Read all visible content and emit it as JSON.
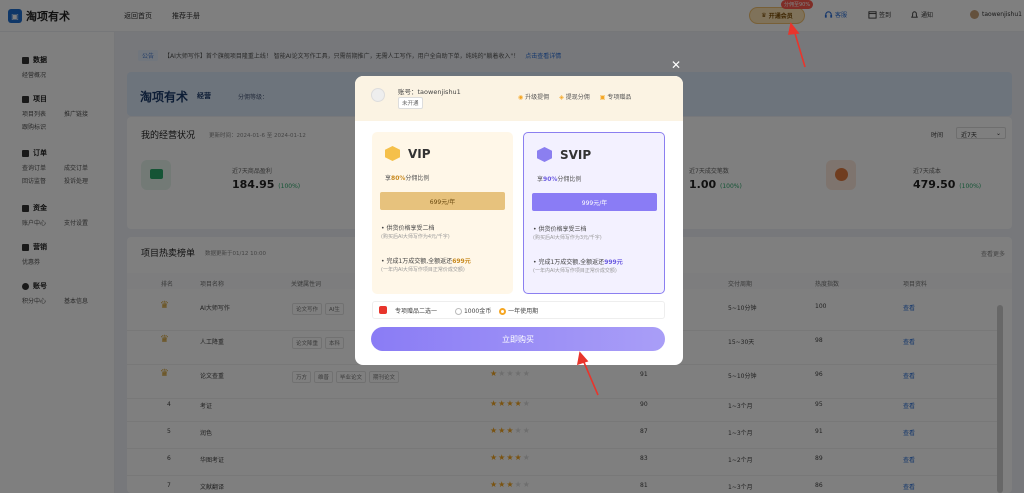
{
  "topbar": {
    "logo_text": "淘项有术",
    "nav": [
      "返回首页",
      "推荐手册"
    ],
    "vip_btn": "开通会员",
    "vip_badge": "分佣至90%",
    "items": [
      "客服",
      "签到",
      "通知"
    ],
    "username": "taowenjishu1"
  },
  "sidebar": {
    "groups": [
      {
        "title": "数据",
        "subs": [
          "经营概况"
        ]
      },
      {
        "title": "项目",
        "subs": [
          "项目列表",
          "推广链接",
          "跟购标识"
        ]
      },
      {
        "title": "订单",
        "subs": [
          "查询订单",
          "成交订单",
          "回访监督",
          "投诉处理"
        ]
      },
      {
        "title": "资金",
        "subs": [
          "账户中心",
          "支付设置"
        ]
      },
      {
        "title": "营销",
        "subs": [
          "优惠券"
        ]
      },
      {
        "title": "账号",
        "subs": [
          "积分中心",
          "基本信息"
        ]
      }
    ]
  },
  "notice": {
    "tag": "公告",
    "text": "【AI大师写作】首个旗舰项目隆重上线！ 智能AI论文写作工具，只需前期推广，无需人工写作，用户全自助下单，纯纯的\"躺着收入\"！",
    "link": "点击查看详情"
  },
  "banner": {
    "title": "淘项有术",
    "sub": "经营",
    "level_label": "分佣等级："
  },
  "overview": {
    "title": "我的经营状况",
    "time": "更新时间：2024-01-6 至 2024-01-12",
    "filter_label": "时间",
    "filter_value": "近7天",
    "stats": [
      {
        "label": "近7天商品盈利",
        "value": "184.95",
        "pct": "(100%)"
      },
      {
        "label": "近7天成交笔数",
        "value": "1.00",
        "pct": "(100%)"
      },
      {
        "label": "近7天成本",
        "value": "479.50",
        "pct": "(100%)"
      }
    ]
  },
  "ranking": {
    "title": "项目热卖榜单",
    "updated": "数据更新于01/12 10:00",
    "more": "查看更多",
    "headers": [
      "排名",
      "项目名称",
      "关键属性词",
      "",
      "交付周期",
      "热度指数",
      "项目资料"
    ],
    "rows": [
      {
        "rank": "1",
        "name": "AI大师写作",
        "tags": [
          "论文写作",
          "AI生"
        ],
        "score": "",
        "cycle": "5~10分钟",
        "heat": "100",
        "link": "查看",
        "stars": 0
      },
      {
        "rank": "2",
        "name": "人工降重",
        "tags": [
          "论文降重",
          "本科"
        ],
        "score": "",
        "cycle": "15~30天",
        "heat": "98",
        "link": "查看",
        "stars": 0
      },
      {
        "rank": "3",
        "name": "论文查重",
        "tags": [
          "万方",
          "维普",
          "毕业论文",
          "期刊论文"
        ],
        "score": "91",
        "cycle": "5~10分钟",
        "heat": "96",
        "link": "查看",
        "stars": 1
      },
      {
        "rank": "4",
        "name": "考证",
        "tags": [],
        "score": "90",
        "cycle": "1~3个月",
        "heat": "95",
        "link": "查看",
        "stars": 4
      },
      {
        "rank": "5",
        "name": "润色",
        "tags": [],
        "score": "87",
        "cycle": "1~3个月",
        "heat": "91",
        "link": "查看",
        "stars": 3
      },
      {
        "rank": "6",
        "name": "华图考证",
        "tags": [],
        "score": "83",
        "cycle": "1~2个月",
        "heat": "89",
        "link": "查看",
        "stars": 4
      },
      {
        "rank": "7",
        "name": "文献翻译",
        "tags": [],
        "score": "81",
        "cycle": "1~3个月",
        "heat": "86",
        "link": "查看",
        "stars": 3
      }
    ]
  },
  "modal": {
    "account_label": "账号：taowenjishu1",
    "status": "未开通",
    "perks": [
      "升级提佣",
      "提现分佣",
      "专项赠品"
    ],
    "vip": {
      "name": "VIP",
      "desc_pre": "享",
      "desc_pct": "80%",
      "desc_post": "分佣比例",
      "price": "699元/年",
      "b1": "供货价格享受二档",
      "b1s": "(购买后AI大师写作为4元/千字)",
      "b2_pre": "完成1万成交额,全额返还",
      "b2_amt": "699元",
      "b2s": "(一年内AI大师写作项目正常价成交额)"
    },
    "svip": {
      "name": "SVIP",
      "desc_pre": "享",
      "desc_pct": "90%",
      "desc_post": "分佣比例",
      "price": "999元/年",
      "b1": "供货价格享受三档",
      "b1s": "(购买后AI大师写作为3元/千字)",
      "b2_pre": "完成1万成交额,全额返还",
      "b2_amt": "999元",
      "b2s": "(一年内AI大师写作项目正常价成交额)"
    },
    "gift_label": "专项赠品二选一",
    "opt1": "1000金币",
    "opt2": "一年使用期",
    "buy": "立即购买"
  },
  "colors": {
    "accent": "#8a7cf5",
    "vip_gold": "#e7c27d",
    "link": "#2a6fd8",
    "arrow": "#e8352c"
  }
}
